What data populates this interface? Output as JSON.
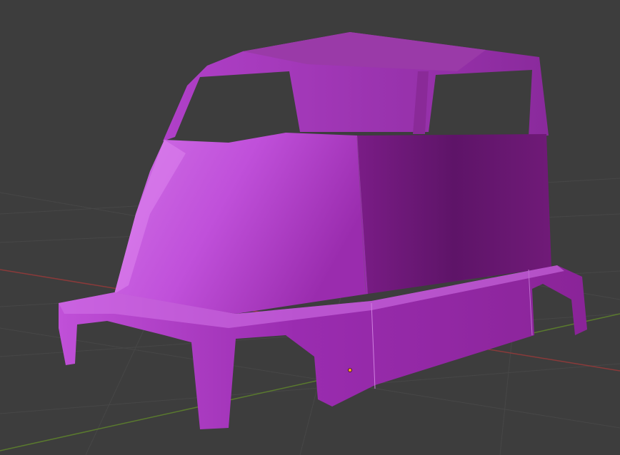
{
  "viewport": {
    "background_color": "#3d3d3d",
    "grid_color": "#474747",
    "x_axis_color": "#8a3a3a",
    "y_axis_color": "#5a7a2e"
  },
  "model": {
    "base_color": "#a82cb8",
    "highlight_color": "#d868ec",
    "shadow_color": "#5c1466",
    "origin_marker_color": "#ffa020"
  }
}
